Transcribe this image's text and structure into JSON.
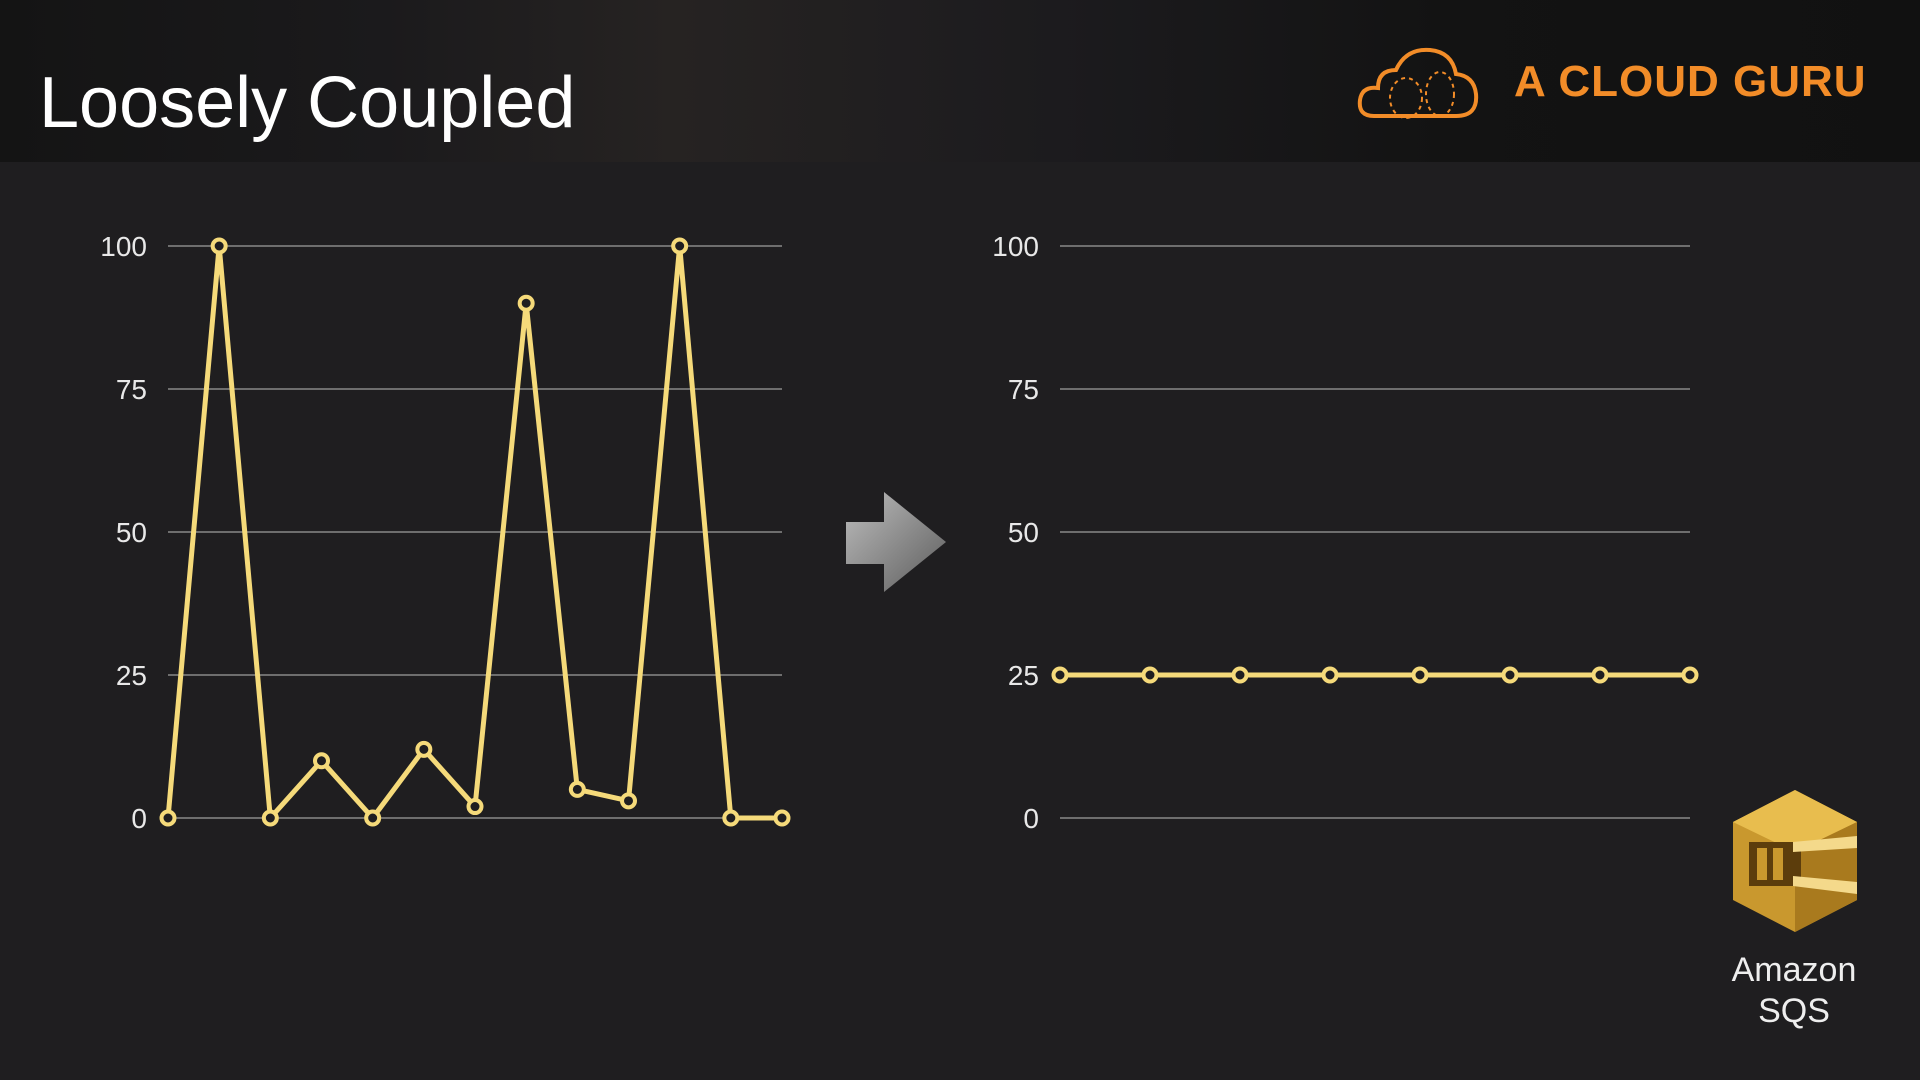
{
  "slide": {
    "title": "Loosely Coupled",
    "logo_text": "A CLOUD GURU",
    "service_label_line1": "Amazon",
    "service_label_line2": "SQS"
  },
  "colors": {
    "background": "#1f1e20",
    "line": "#f5da7a",
    "brand": "#f28c28",
    "grid": "#bdbdbd"
  },
  "icons": {
    "logo": "cloud-icon",
    "arrow": "arrow-right-icon",
    "service": "amazon-sqs-icon"
  },
  "chart_data": [
    {
      "type": "line",
      "title": "",
      "xlabel": "",
      "ylabel": "",
      "ylim": [
        0,
        100
      ],
      "yticks": [
        0,
        25,
        50,
        75,
        100
      ],
      "grid": true,
      "x": [
        1,
        2,
        3,
        4,
        5,
        6,
        7,
        8,
        9,
        10,
        11,
        12,
        13
      ],
      "series": [
        {
          "values": [
            0,
            100,
            0,
            10,
            0,
            12,
            2,
            90,
            5,
            3,
            100,
            0,
            0
          ]
        }
      ]
    },
    {
      "type": "line",
      "title": "",
      "xlabel": "",
      "ylabel": "",
      "ylim": [
        0,
        100
      ],
      "yticks": [
        0,
        25,
        50,
        75,
        100
      ],
      "grid": true,
      "x": [
        1,
        2,
        3,
        4,
        5,
        6,
        7,
        8
      ],
      "series": [
        {
          "values": [
            25,
            25,
            25,
            25,
            25,
            25,
            25,
            25
          ]
        }
      ]
    }
  ]
}
